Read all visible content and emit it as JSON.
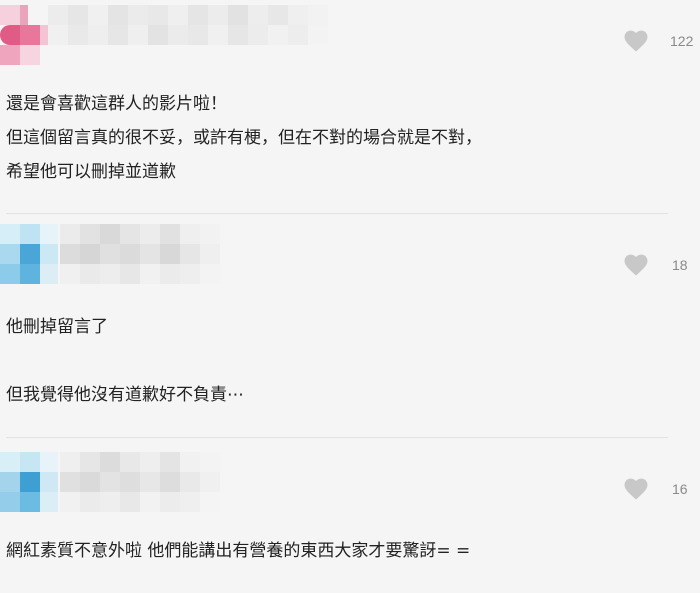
{
  "comments": [
    {
      "likes": "122",
      "lines": [
        "還是會喜歡這群人的影片啦！",
        "但這個留言真的很不妥，或許有梗，但在不對的場合就是不對，",
        "希望他可以刪掉並道歉"
      ],
      "avatar_colors": [
        "#e8779b",
        "#e05c86",
        "#f0a5bf",
        "#ec96b2"
      ]
    },
    {
      "likes": "18",
      "lines": [
        "他刪掉留言了",
        "",
        "但我覺得他沒有道歉好不負責⋯"
      ],
      "avatar_colors": [
        "#bfe3f3",
        "#5fb3df",
        "#a9d8ef",
        "#4aa6d6"
      ]
    },
    {
      "likes": "16",
      "lines": [
        "網紅素質不意外啦 他們能講出有營養的東西大家才要驚訝= ="
      ],
      "avatar_colors": [
        "#c6e6f4",
        "#6bbbe3",
        "#a3d4ec",
        "#3d9fd2"
      ]
    }
  ],
  "heart_icon_color": "#c8c8c8"
}
